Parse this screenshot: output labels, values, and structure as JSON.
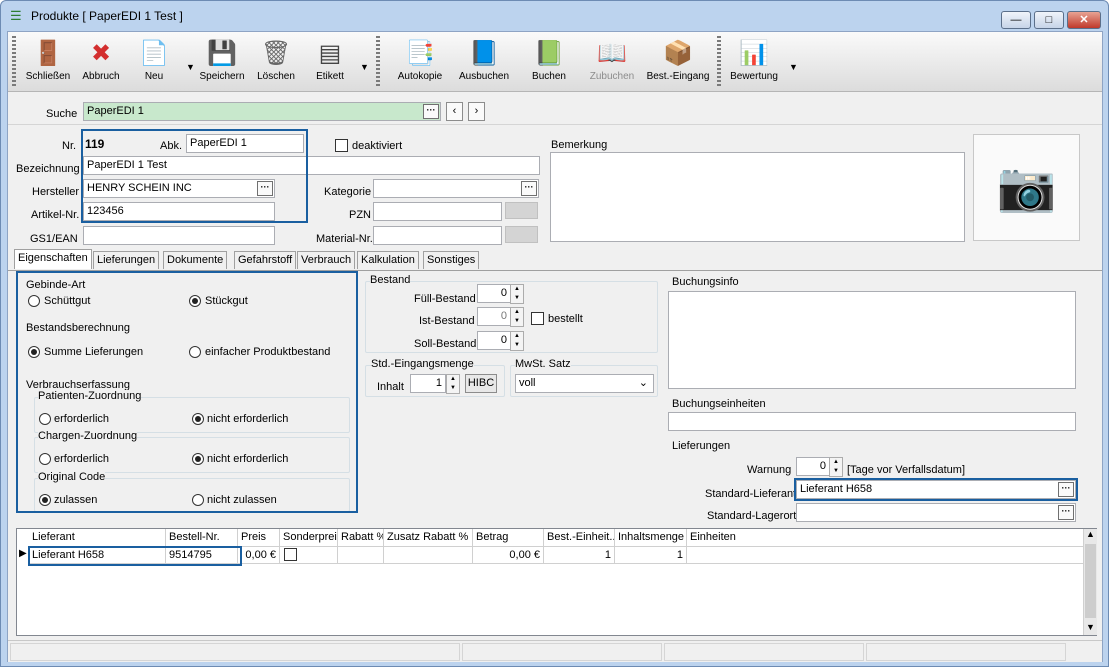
{
  "window": {
    "title": "Produkte [ PaperEDI 1 Test ]",
    "icon": "stack-icon"
  },
  "toolbar": {
    "items": [
      {
        "label": "Schließen",
        "icon": "close-door-icon"
      },
      {
        "label": "Abbruch",
        "icon": "cancel-icon"
      },
      {
        "label": "Neu",
        "icon": "new-document-icon"
      },
      {
        "label": "Speichern",
        "icon": "save-icon"
      },
      {
        "label": "Löschen",
        "icon": "trash-icon"
      },
      {
        "label": "Etikett",
        "icon": "barcode-printer-icon"
      },
      {
        "label": "Autokopie",
        "icon": "copy-icon"
      },
      {
        "label": "Ausbuchen",
        "icon": "book-out-icon"
      },
      {
        "label": "Buchen",
        "icon": "book-in-icon"
      },
      {
        "label": "Zubuchen",
        "icon": "book-add-icon"
      },
      {
        "label": "Best.-Eingang",
        "icon": "package-icon"
      },
      {
        "label": "Bewertung",
        "icon": "rating-chart-icon"
      }
    ]
  },
  "search": {
    "label": "Suche",
    "value": "PaperEDI 1"
  },
  "form": {
    "nr_label": "Nr.",
    "nr_value": "119",
    "abk_label": "Abk.",
    "abk_value": "PaperEDI 1",
    "deaktiviert_label": "deaktiviert",
    "bezeichnung_label": "Bezeichnung",
    "bezeichnung_value": "PaperEDI 1 Test",
    "hersteller_label": "Hersteller",
    "hersteller_value": "HENRY SCHEIN INC",
    "kategorie_label": "Kategorie",
    "kategorie_value": "",
    "artikelnr_label": "Artikel-Nr.",
    "artikelnr_value": "123456",
    "pzn_label": "PZN",
    "pzn_value": "",
    "gs1_label": "GS1/EAN",
    "gs1_value": "",
    "materialnr_label": "Material-Nr.",
    "materialnr_value": "",
    "bemerkung_label": "Bemerkung",
    "bemerkung_value": ""
  },
  "tabs": [
    "Eigenschaften",
    "Lieferungen",
    "Dokumente",
    "Gefahrstoff",
    "Verbrauch",
    "Kalkulation",
    "Sonstiges"
  ],
  "eigenschaften": {
    "gebinde_title": "Gebinde-Art",
    "schuettgut": "Schüttgut",
    "stueckgut": "Stückgut",
    "bestandsberechnung_title": "Bestandsberechnung",
    "summe": "Summe Lieferungen",
    "einfacher": "einfacher Produktbestand",
    "verbrauch_title": "Verbrauchserfassung",
    "patienten_title": "Patienten-Zuordnung",
    "chargen_title": "Chargen-Zuordnung",
    "original_title": "Original Code",
    "erforderlich": "erforderlich",
    "nicht_erforderlich": "nicht erforderlich",
    "zulassen": "zulassen",
    "nicht_zulassen": "nicht zulassen"
  },
  "bestand": {
    "title": "Bestand",
    "fuell_label": "Füll-Bestand",
    "fuell_value": "0",
    "ist_label": "Ist-Bestand",
    "ist_value": "0",
    "soll_label": "Soll-Bestand",
    "soll_value": "0",
    "bestellt_label": "bestellt"
  },
  "std": {
    "title": "Std.-Eingangsmenge",
    "inhalt_label": "Inhalt",
    "inhalt_value": "1",
    "hibc": "HIBC"
  },
  "mwst": {
    "title": "MwSt. Satz",
    "value": "voll"
  },
  "buchungsinfo": {
    "title": "Buchungsinfo"
  },
  "buchungseinheiten": {
    "title": "Buchungseinheiten"
  },
  "lieferungen": {
    "title": "Lieferungen",
    "warnung_label": "Warnung",
    "warnung_value": "0",
    "warnung_unit": "[Tage vor Verfallsdatum]",
    "std_lieferant_label": "Standard-Lieferant",
    "std_lieferant_value": "Lieferant H658",
    "std_lagerort_label": "Standard-Lagerort",
    "std_lagerort_value": ""
  },
  "grid": {
    "columns": [
      "Lieferant",
      "Bestell-Nr.",
      "Preis",
      "Sonderpreis",
      "Rabatt %",
      "Zusatz Rabatt %",
      "Betrag",
      "Best.-Einheit...",
      "Inhaltsmenge",
      "Einheiten"
    ],
    "rows": [
      {
        "lieferant": "Lieferant H658",
        "bestellnr": "9514795",
        "preis": "0,00 €",
        "betrag": "0,00 €",
        "best_einheit": "1",
        "inhaltsmenge": "1"
      }
    ]
  }
}
